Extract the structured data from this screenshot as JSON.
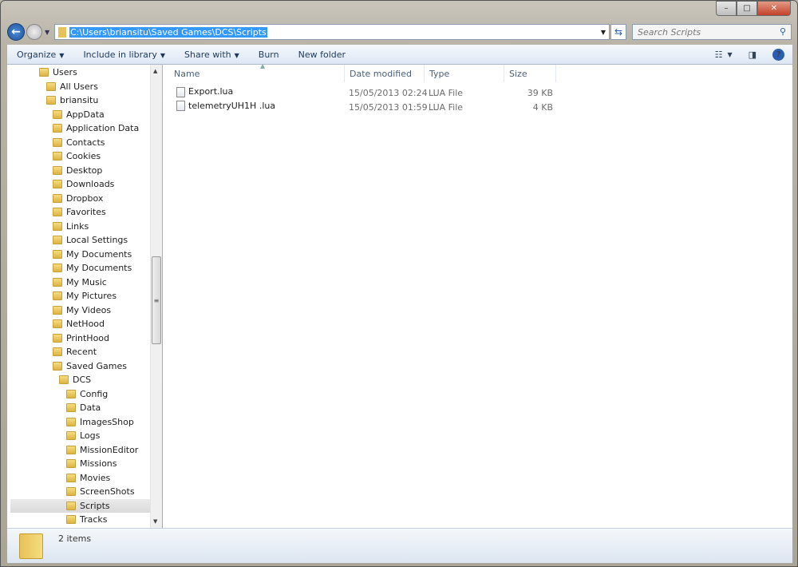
{
  "window": {
    "controls": {
      "minimize": "–",
      "maximize": "□",
      "close": "✕"
    }
  },
  "address": {
    "path": "C:\\Users\\briansitu\\Saved Games\\DCS\\Scripts"
  },
  "search": {
    "placeholder": "Search Scripts"
  },
  "toolbar": {
    "organize": "Organize",
    "include": "Include in library",
    "share": "Share with",
    "burn": "Burn",
    "new_folder": "New folder"
  },
  "tree": [
    {
      "label": "Users",
      "level": 0
    },
    {
      "label": "All Users",
      "level": 1
    },
    {
      "label": "briansitu",
      "level": 1
    },
    {
      "label": "AppData",
      "level": 2
    },
    {
      "label": "Application Data",
      "level": 2
    },
    {
      "label": "Contacts",
      "level": 2
    },
    {
      "label": "Cookies",
      "level": 2
    },
    {
      "label": "Desktop",
      "level": 2
    },
    {
      "label": "Downloads",
      "level": 2
    },
    {
      "label": "Dropbox",
      "level": 2
    },
    {
      "label": "Favorites",
      "level": 2
    },
    {
      "label": "Links",
      "level": 2
    },
    {
      "label": "Local Settings",
      "level": 2
    },
    {
      "label": "My Documents",
      "level": 2
    },
    {
      "label": "My Documents",
      "level": 2
    },
    {
      "label": "My Music",
      "level": 2
    },
    {
      "label": "My Pictures",
      "level": 2
    },
    {
      "label": "My Videos",
      "level": 2
    },
    {
      "label": "NetHood",
      "level": 2
    },
    {
      "label": "PrintHood",
      "level": 2
    },
    {
      "label": "Recent",
      "level": 2
    },
    {
      "label": "Saved Games",
      "level": 2
    },
    {
      "label": "DCS",
      "level": 3
    },
    {
      "label": "Config",
      "level": 4
    },
    {
      "label": "Data",
      "level": 4
    },
    {
      "label": "ImagesShop",
      "level": 4
    },
    {
      "label": "Logs",
      "level": 4
    },
    {
      "label": "MissionEditor",
      "level": 4
    },
    {
      "label": "Missions",
      "level": 4
    },
    {
      "label": "Movies",
      "level": 4
    },
    {
      "label": "ScreenShots",
      "level": 4
    },
    {
      "label": "Scripts",
      "level": 4,
      "selected": true
    },
    {
      "label": "Tracks",
      "level": 4
    }
  ],
  "columns": {
    "name": "Name",
    "date": "Date modified",
    "type": "Type",
    "size": "Size"
  },
  "files": [
    {
      "name": "Export.lua",
      "date": "15/05/2013 02:24 ...",
      "type": "LUA File",
      "size": "39 KB"
    },
    {
      "name": "telemetryUH1H .lua",
      "date": "15/05/2013 01:59 ...",
      "type": "LUA File",
      "size": "4 KB"
    }
  ],
  "status": {
    "count": "2 items"
  }
}
